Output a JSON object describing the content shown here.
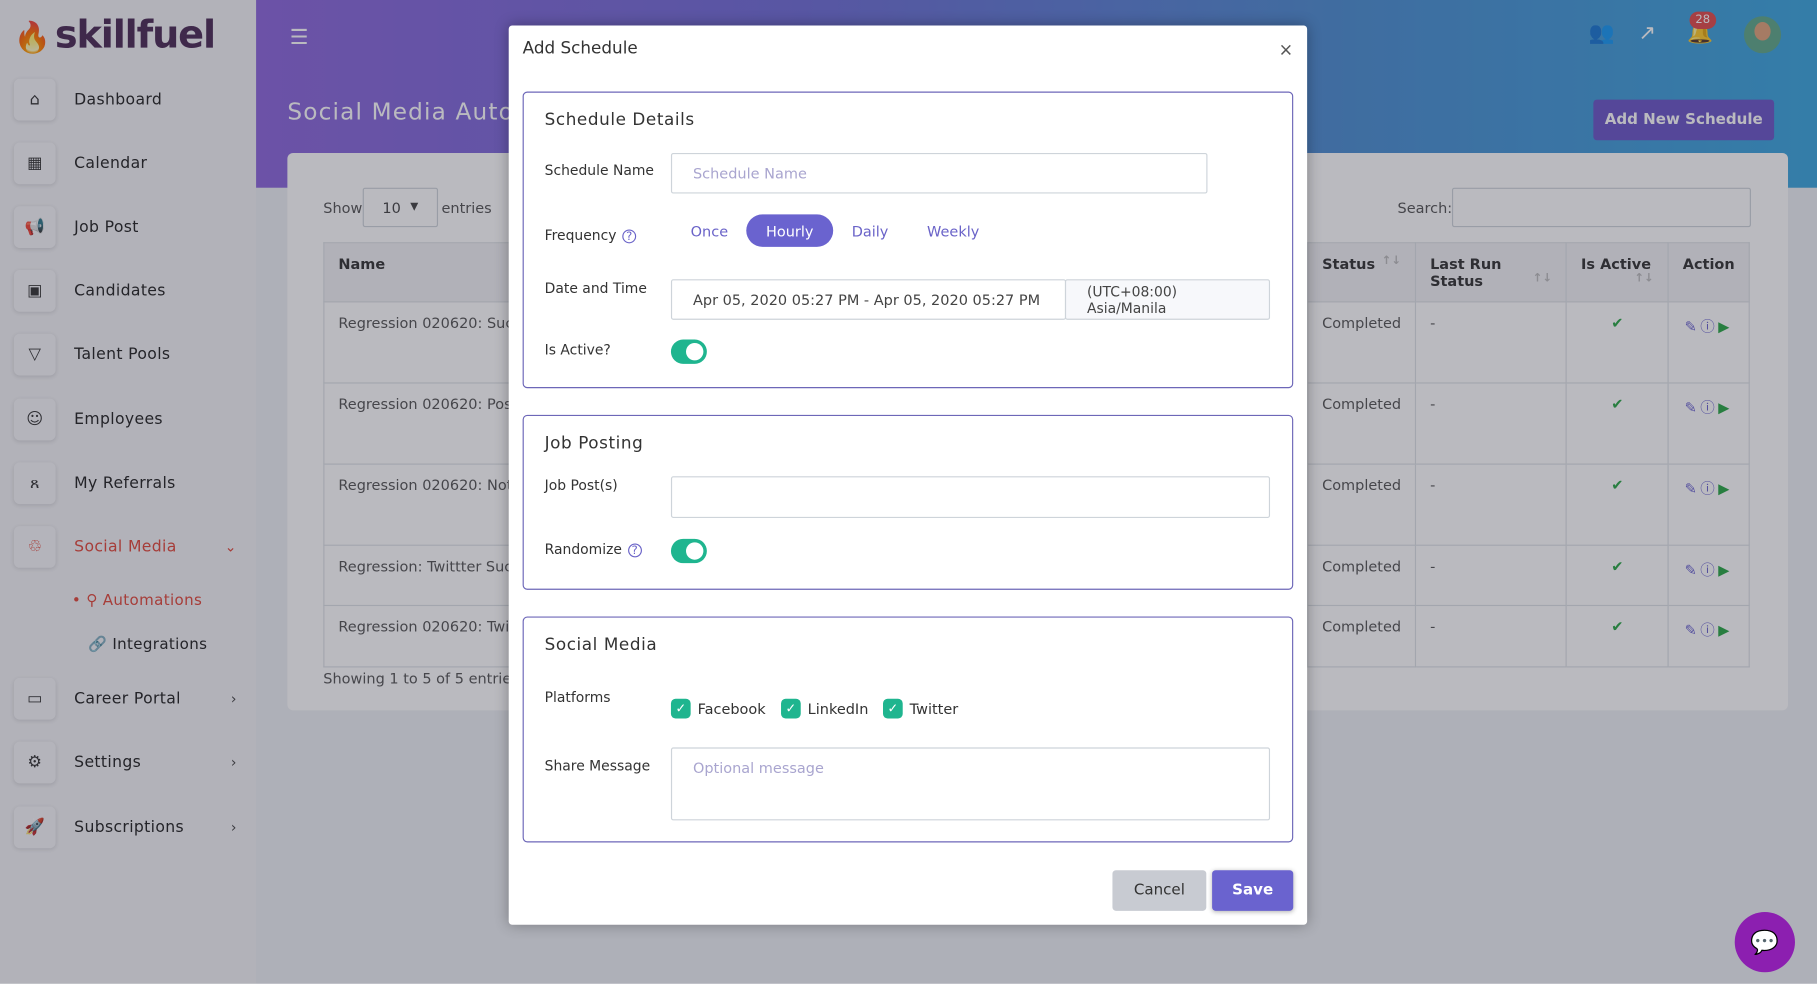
{
  "brand": {
    "logo": "skillfuel",
    "accent": "#6a63cf",
    "danger": "#e2473a"
  },
  "sidebar": {
    "items": [
      {
        "label": "Dashboard",
        "icon": "home-icon"
      },
      {
        "label": "Calendar",
        "icon": "calendar-icon"
      },
      {
        "label": "Job Post",
        "icon": "megaphone-icon"
      },
      {
        "label": "Candidates",
        "icon": "id-card-icon"
      },
      {
        "label": "Talent Pools",
        "icon": "filter-icon"
      },
      {
        "label": "Employees",
        "icon": "user-icon"
      },
      {
        "label": "My Referrals",
        "icon": "users-icon"
      },
      {
        "label": "Social Media",
        "icon": "share-icon",
        "active": true,
        "expanded": true
      },
      {
        "label": "Career Portal",
        "icon": "monitor-icon"
      },
      {
        "label": "Settings",
        "icon": "gear-icon"
      },
      {
        "label": "Subscriptions",
        "icon": "rocket-icon"
      }
    ],
    "sub_items": [
      {
        "label": "Automations",
        "active": true
      },
      {
        "label": "Integrations"
      }
    ]
  },
  "header": {
    "page_title": "Social Media Automations",
    "add_button": "Add New Schedule",
    "notification_count": "28"
  },
  "table": {
    "show_label": "Show",
    "entries_value": "10",
    "entries_label": "entries",
    "search_label": "Search:",
    "columns": [
      "Name",
      "Status",
      "Last Run Status",
      "Is Active",
      "Action"
    ],
    "rows": [
      {
        "name": "Regression 020620: Succe",
        "status": "Completed",
        "last_run": "-"
      },
      {
        "name": "Regression 020620: Post A",
        "status": "Completed",
        "last_run": "-"
      },
      {
        "name": "Regression 020620: Not Po",
        "status": "Completed",
        "last_run": "-"
      },
      {
        "name": "Regression: Twittter Succe",
        "status": "Completed",
        "last_run": "-"
      },
      {
        "name": "Regression 020620: Twitte Post",
        "status": "Completed",
        "last_run": "-"
      }
    ],
    "footer": "Showing 1 to 5 of 5 entries"
  },
  "modal": {
    "title": "Add Schedule",
    "close": "×",
    "schedule": {
      "heading": "Schedule Details",
      "name_label": "Schedule Name",
      "name_placeholder": "Schedule Name",
      "frequency_label": "Frequency",
      "frequency_options": [
        "Once",
        "Hourly",
        "Daily",
        "Weekly"
      ],
      "frequency_selected": "Hourly",
      "datetime_label": "Date and Time",
      "datetime_value": "Apr 05, 2020 05:27 PM - Apr 05, 2020 05:27 PM",
      "timezone": "(UTC+08:00) Asia/Manila",
      "active_label": "Is Active?",
      "active": true
    },
    "job": {
      "heading": "Job Posting",
      "posts_label": "Job Post(s)",
      "randomize_label": "Randomize",
      "randomize": true
    },
    "social": {
      "heading": "Social Media",
      "platforms_label": "Platforms",
      "platforms": [
        "Facebook",
        "LinkedIn",
        "Twitter"
      ],
      "message_label": "Share Message",
      "message_placeholder": "Optional message"
    },
    "cancel": "Cancel",
    "save": "Save"
  }
}
